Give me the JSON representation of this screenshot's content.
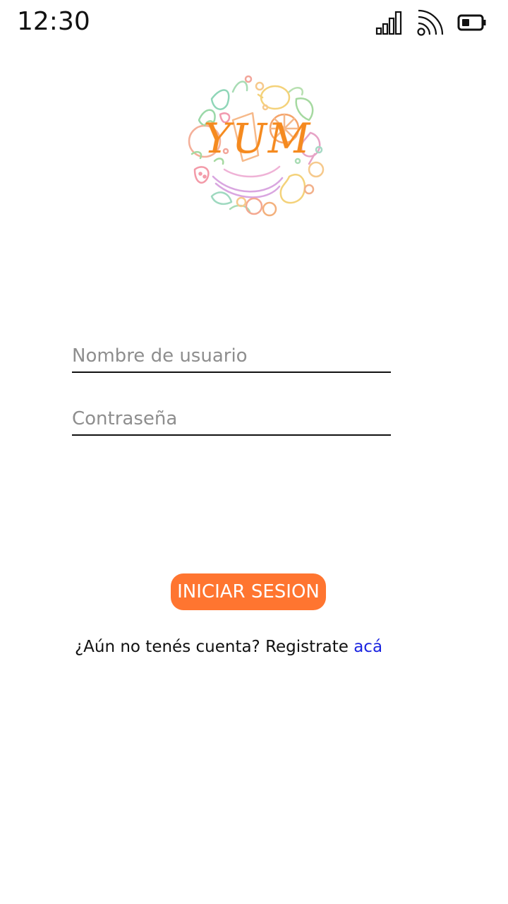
{
  "status_bar": {
    "time": "12:30",
    "icons": [
      "signal-icon",
      "wifi-icon",
      "battery-icon"
    ]
  },
  "logo": {
    "word": "YUM",
    "accent_color": "#f58a1f"
  },
  "form": {
    "username": {
      "placeholder": "Nombre de usuario",
      "value": ""
    },
    "password": {
      "placeholder": "Contraseña",
      "value": ""
    }
  },
  "login_button": {
    "label": "INICIAR SESION",
    "color": "#ff7530"
  },
  "register": {
    "prompt": "¿Aún no tenés cuenta? Registrate ",
    "link_text": "acá",
    "link_color": "#1a23e0"
  }
}
